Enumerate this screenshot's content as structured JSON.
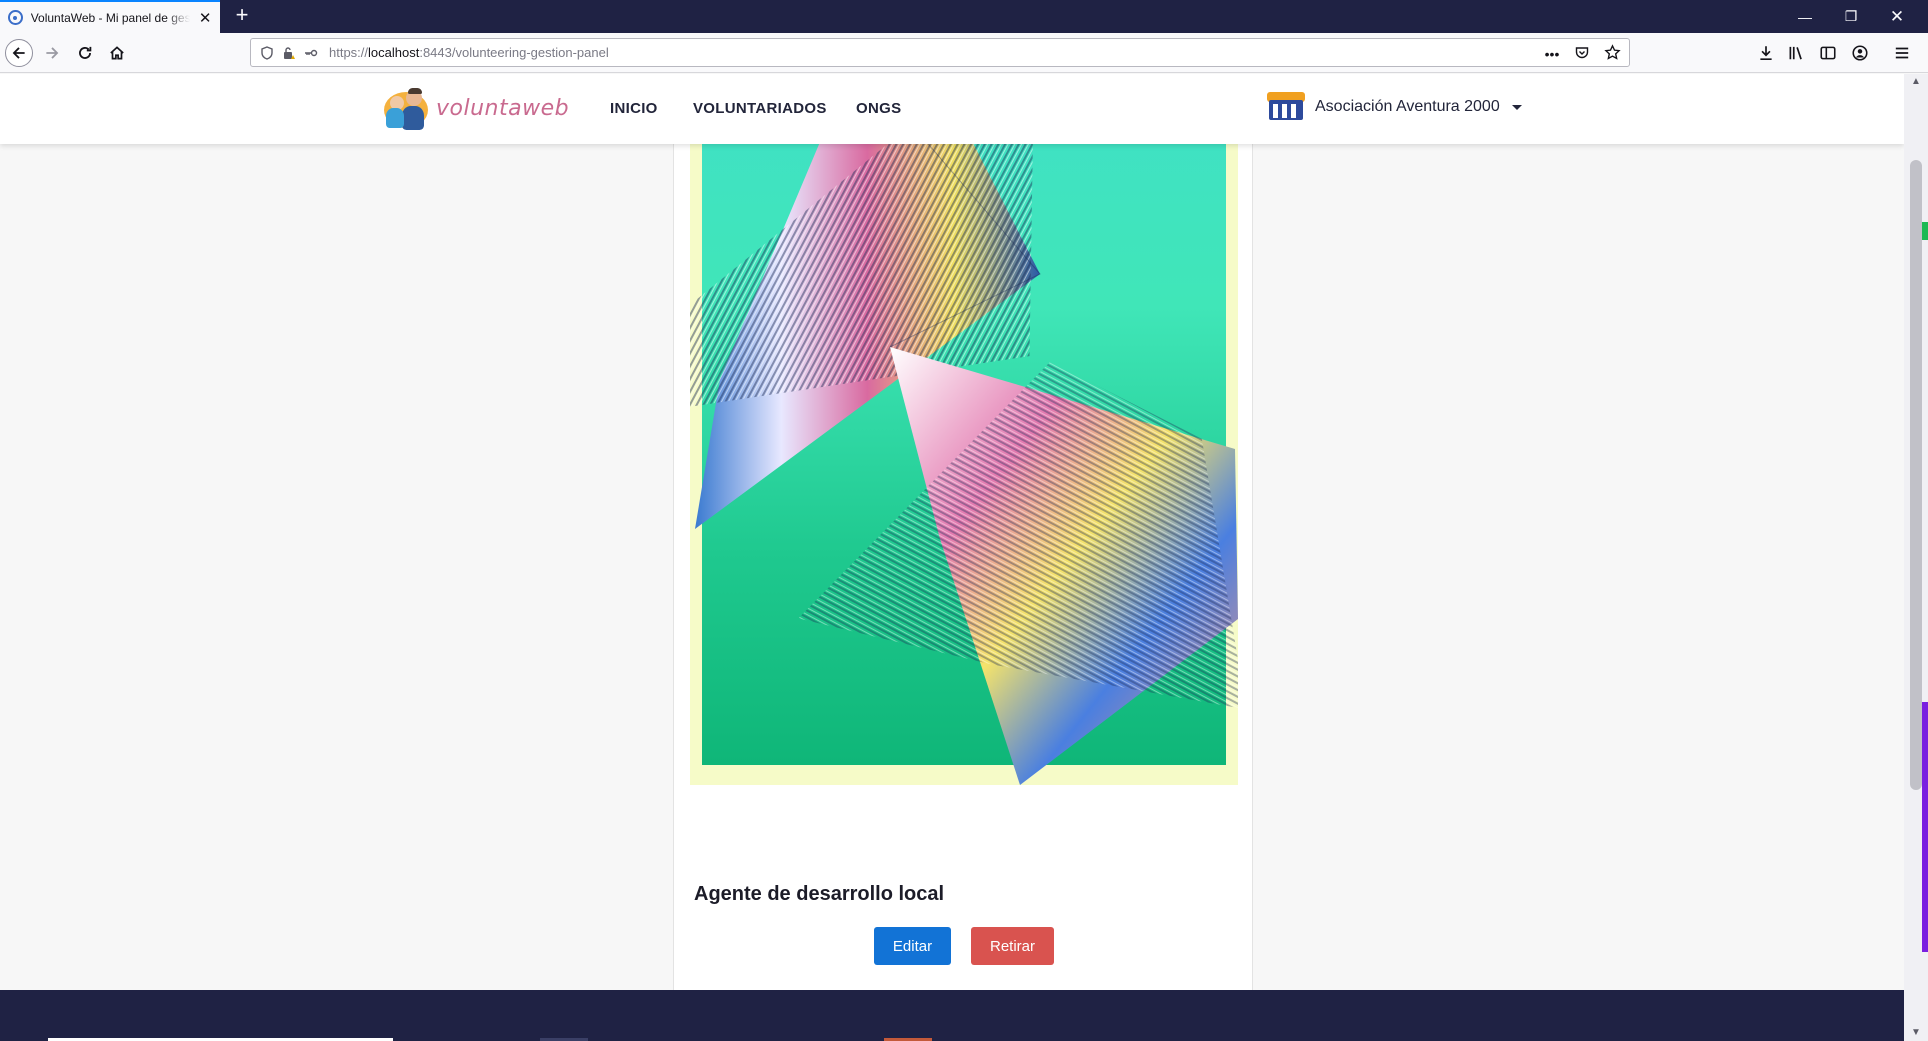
{
  "browser": {
    "tab_title": "VoluntaWeb - Mi panel de gestión",
    "tab_close": "✕",
    "new_tab": "+",
    "url_scheme": "https://",
    "url_host": "localhost",
    "url_rest": ":8443/volunteering-gestion-panel",
    "url_more": "•••"
  },
  "header": {
    "logo_text": "voluntaweb",
    "nav": [
      "INICIO",
      "VOLUNTARIADOS",
      "ONGS"
    ],
    "org_name": "Asociación Aventura 2000"
  },
  "card": {
    "title": "Agente de desarrollo local",
    "edit_label": "Editar",
    "remove_label": "Retirar"
  },
  "colors": {
    "header_bg": "#ffffff",
    "footer_bg": "#1f2244",
    "edit_button": "#1273d6",
    "remove_button": "#d9534f",
    "logo_text": "#c96a8f"
  }
}
